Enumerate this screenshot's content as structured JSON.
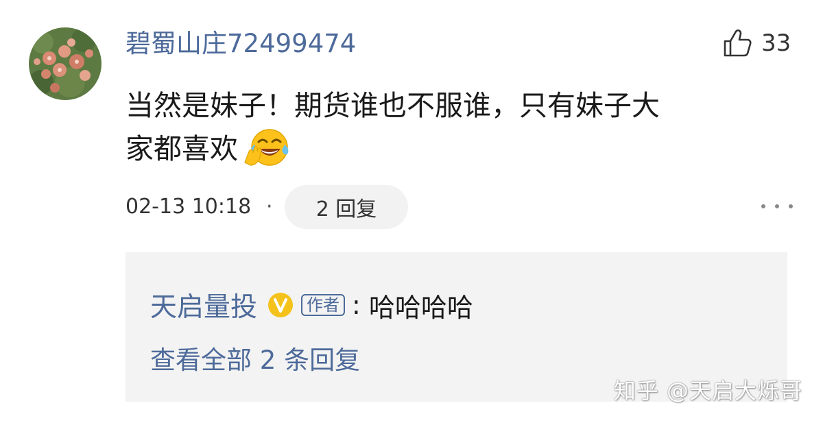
{
  "comment": {
    "avatar_icon": "flower-photo-avatar",
    "username": "碧蜀山庄72499474",
    "like_icon": "thumbs-up-icon",
    "like_count": "33",
    "text_line1": "当然是妹子！期货谁也不服谁，只有妹子大",
    "text_line2": "家都喜欢",
    "emoji_icon": "laughing-tears-emoji",
    "time": "02-13 10:18",
    "separator": "·",
    "reply_button": "2 回复",
    "more_icon": "more-dots-icon"
  },
  "reply": {
    "author": "天启量投",
    "verified_icon": "verified-v-badge",
    "author_tag": "作者",
    "colon": ":",
    "content": "哈哈哈哈",
    "view_all": "查看全部 2 条回复"
  },
  "watermark": "知乎 @天启大烁哥",
  "colors": {
    "link_blue": "#4d6a9a",
    "text": "#1a1a1a",
    "reply_bg": "#f3f3f3",
    "badge_yellow": "#f4c21b"
  }
}
